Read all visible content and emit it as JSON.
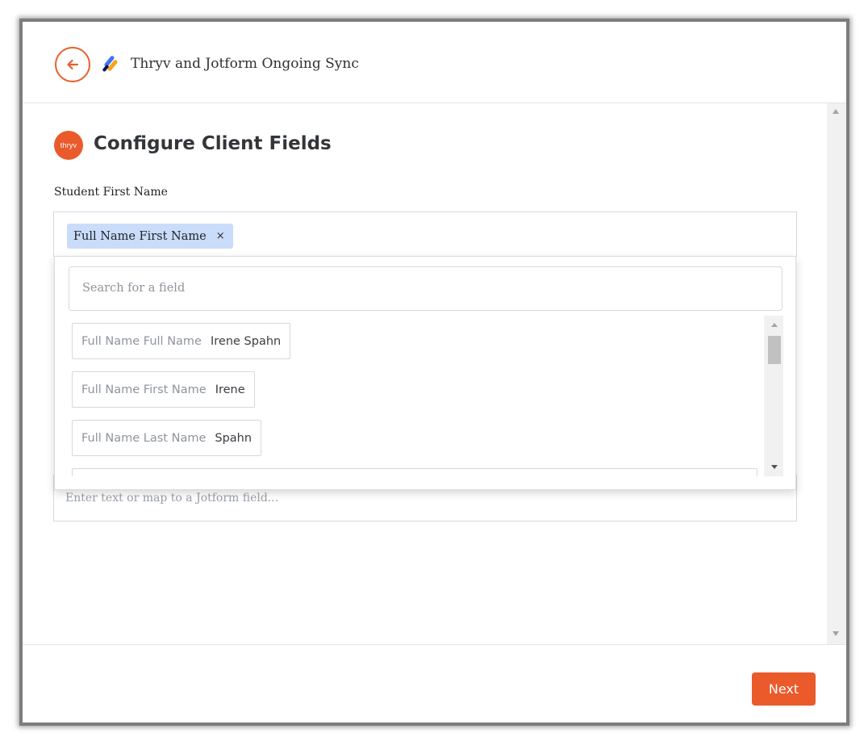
{
  "header": {
    "title": "Thryv and Jotform Ongoing Sync",
    "back_icon": "arrow-left-icon",
    "app_icon": "sync-app-logo"
  },
  "section": {
    "badge_text": "thryv",
    "title": "Configure Client Fields"
  },
  "field": {
    "label": "Student First Name",
    "chip_label": "Full Name First Name",
    "chip_remove": "×"
  },
  "dropdown": {
    "search_placeholder": "Search for a field",
    "options": [
      {
        "name": "Full Name Full Name",
        "value": "Irene Spahn"
      },
      {
        "name": "Full Name First Name",
        "value": "Irene"
      },
      {
        "name": "Full Name Last Name",
        "value": "Spahn"
      }
    ]
  },
  "second_field": {
    "placeholder": "Enter text or map to a Jotform field..."
  },
  "footer": {
    "next_label": "Next"
  },
  "colors": {
    "accent": "#ea5a2a",
    "chip_bg": "#c9dcf9"
  }
}
